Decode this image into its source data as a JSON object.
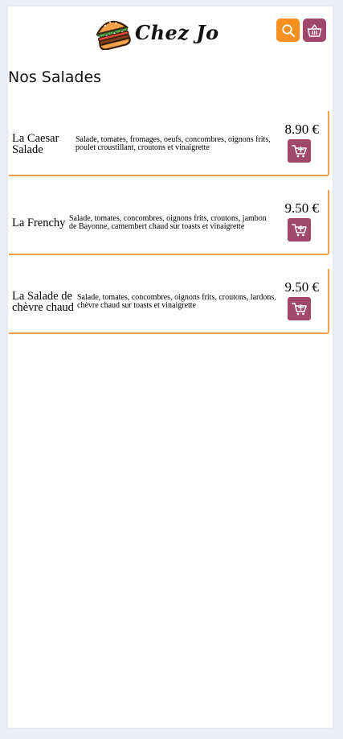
{
  "brand": {
    "name": "Chez Jo"
  },
  "header": {
    "search_icon": "search-icon",
    "basket_icon": "basket-icon",
    "colors": {
      "search_button": "#f7901e",
      "basket_button": "#a0486a"
    }
  },
  "section": {
    "title": "Nos Salades"
  },
  "items": [
    {
      "name": "La Caesar Salade",
      "description": "Salade, tomates, fromages, oeufs, concombres, oignons frits, poulet croustillant, croutons et vinaigrette",
      "price": "8.90 €",
      "cart_icon": "add-to-cart-icon"
    },
    {
      "name": "La Frenchy",
      "description": "Salade, tomates, concombres, oignons frits, croutons, jambon de Bayonne, camembert chaud sur toasts et vinaigrette",
      "price": "9.50 €",
      "cart_icon": "add-to-cart-icon"
    },
    {
      "name": "La Salade de chèvre chaud",
      "description": "Salade, tomates, concombres, oignons frits, croutons, lardons, chèvre chaud sur toasts et vinaigrette",
      "price": "9.50 €",
      "cart_icon": "add-to-cart-icon"
    }
  ],
  "colors": {
    "accent_orange": "#f4a24d",
    "accent_plum": "#a0486a",
    "page_background": "#e9eef6"
  }
}
